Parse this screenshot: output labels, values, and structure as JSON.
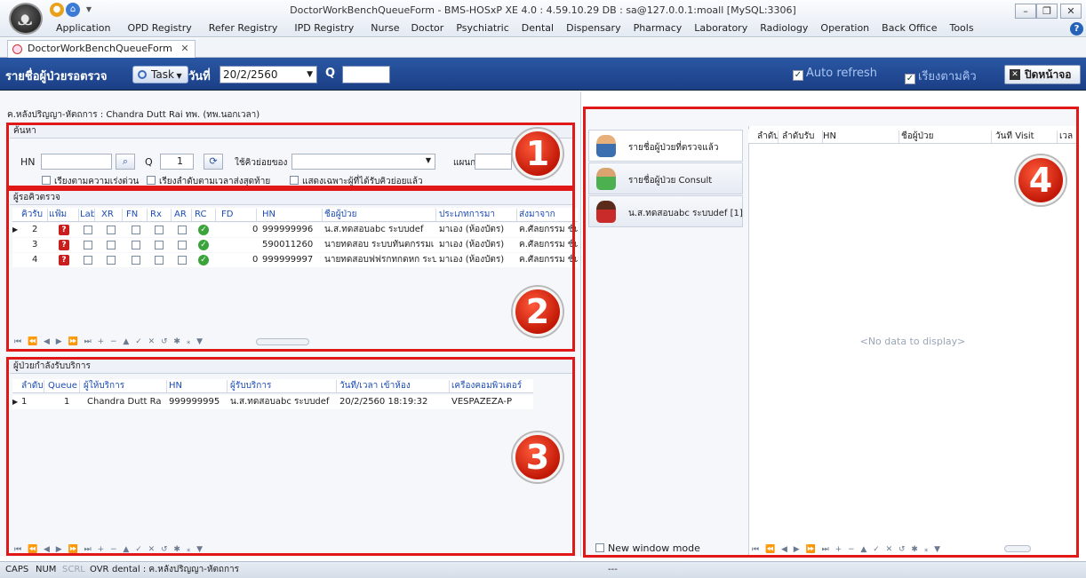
{
  "window": {
    "title": "DoctorWorkBenchQueueForm - BMS-HOSxP XE 4.0 : 4.59.10.29 DB : sa@127.0.0.1:moall [MySQL:3306]"
  },
  "menu": [
    "Application",
    "OPD Registry",
    "Refer Registry",
    "IPD Registry",
    "Nurse",
    "Doctor",
    "Psychiatric",
    "Dental",
    "Dispensary",
    "Pharmacy",
    "Laboratory",
    "Radiology",
    "Operation",
    "Back Office",
    "Tools"
  ],
  "tab": {
    "label": "DoctorWorkBenchQueueForm"
  },
  "toolbar": {
    "title": "รายชื่อผู้ป่วยรอตรวจ",
    "task_label": "Task",
    "date_label": "วันที่",
    "date_value": "20/2/2560",
    "q_label": "Q",
    "auto_refresh": "Auto refresh",
    "sort_queue": "เรียงตามคิว",
    "close_page": "ปิดหน้าจอ"
  },
  "doctor_line": "ค.หลังปริญญา-หัตถการ : Chandra Dutt Rai ทพ. (ทพ.นอกเวลา)",
  "search": {
    "header": "ค้นหา",
    "hn_label": "HN",
    "q_label": "Q",
    "q_value": "1",
    "subqueue_label": "ใช้คิวย่อยของ",
    "dept_label": "แผนก",
    "chk_urgent": "เรียงตามความเร่งด่วน",
    "chk_last_sent": "เรียงลำดับตามเวลาส่งสุดท้าย",
    "chk_received": "แสดงเฉพาะผู้ที่ได้รับคิวย่อยแล้ว"
  },
  "waiting": {
    "header": "ผู้รอคิวตรวจ",
    "columns": [
      "คิวรับ",
      "แฟ้ม",
      "Lab",
      "XR",
      "FN",
      "Rx",
      "AR",
      "RC",
      "FD",
      "HN",
      "ชื่อผู้ป่วย",
      "ประเภทการมา",
      "ส่งมาจาก"
    ],
    "rows": [
      {
        "q": "2",
        "fd": "0",
        "hn": "999999996",
        "name": "น.ส.ทดสอบabc ระบบdef",
        "type": "มาเอง (ห้องบัตร)",
        "from": "ค.ศัลยกรรม ชั้น"
      },
      {
        "q": "3",
        "fd": "",
        "hn": "590011260",
        "name": "นายทดสอบ ระบบทันตกรรมเ",
        "type": "มาเอง (ห้องบัตร)",
        "from": "ค.ศัลยกรรม ชั้น"
      },
      {
        "q": "4",
        "fd": "0",
        "hn": "999999997",
        "name": "นายทดสอบฟฟรกทกดหก ระบ",
        "type": "มาเอง (ห้องบัตร)",
        "from": "ค.ศัลยกรรม ชั้น"
      }
    ]
  },
  "serving": {
    "header": "ผู้ป่วยกำลังรับบริการ",
    "columns": [
      "ลำดับ",
      "Queue",
      "ผู้ให้บริการ",
      "HN",
      "ผู้รับบริการ",
      "วันที่/เวลา เข้าห้อง",
      "เครื่องคอมพิวเตอร์"
    ],
    "rows": [
      {
        "no": "1",
        "queue": "1",
        "provider": "Chandra Dutt Ra",
        "hn": "999999995",
        "patient": "น.ส.ทดสอบabc ระบบdef",
        "datetime": "20/2/2560 18:19:32",
        "computer": "VESPAZEZA-P"
      }
    ]
  },
  "right": {
    "nav": [
      "รายชื่อผู้ป่วยที่ตรวจแล้ว",
      "รายชื่อผู้ป่วย Consult",
      "น.ส.ทดสอบabc ระบบdef [1]"
    ],
    "columns": [
      "ลำดับ",
      "ลำดับรับ",
      "HN",
      "ชื่อผู้ป่วย",
      "วันที่ Visit",
      "เวล"
    ],
    "no_data": "<No data to display>",
    "new_window": "New window mode"
  },
  "badges": [
    "1",
    "2",
    "3",
    "4"
  ],
  "status": {
    "caps": "CAPS",
    "num": "NUM",
    "scrl": "SCRL",
    "ovr": "OVR",
    "info": "dental : ค.หลังปริญญา-หัตถการ",
    "dash": "---"
  },
  "colors": {
    "toolbar": "#1f4890",
    "highlight": "#e01818",
    "link": "#1d4db5"
  }
}
